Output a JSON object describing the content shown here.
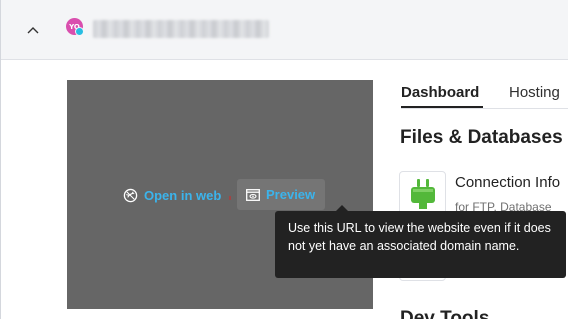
{
  "header": {
    "avatar_initials": "YO",
    "collapse_icon": "chevron-up-icon"
  },
  "preview_panel": {
    "open_in_web_label": "Open in web",
    "open_in_web_icon": "globe-icon",
    "preview_label": "Preview",
    "preview_icon": "preview-window-icon"
  },
  "tabs": [
    {
      "label": "Dashboard",
      "active": true
    },
    {
      "label": "Hosting",
      "active": false
    }
  ],
  "section": {
    "title": "Files & Databases",
    "tools": [
      {
        "title": "Connection Info",
        "description": "for FTP, Database",
        "icon": "plug-icon"
      }
    ]
  },
  "next_section": {
    "title": "Dev Tools"
  },
  "tooltip": {
    "text": "Use this URL to view the website even if it does not yet have an associated domain name."
  },
  "colors": {
    "link": "#3bb4ec",
    "tooltip_bg": "#222222",
    "panel_bg": "#666666",
    "plug_green": "#53b83a"
  }
}
